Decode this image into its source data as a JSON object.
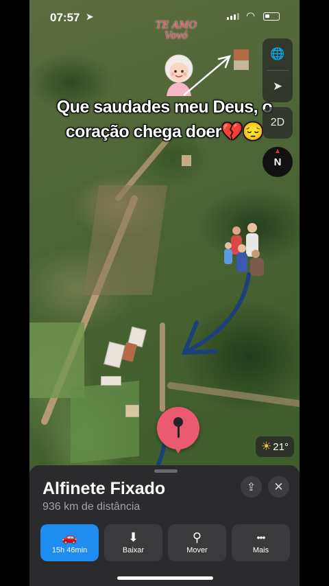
{
  "status_bar": {
    "time": "07:57"
  },
  "overlay": {
    "sticker_text_line1": "TE AMO",
    "sticker_text_line2": "Vovó",
    "caption_line1": "Que saudades meu Deus, o",
    "caption_line2": "coração chega doer💔😔"
  },
  "map_controls": {
    "globe_icon": "🌐",
    "location_icon": "➤",
    "view_mode_label": "2D",
    "compass_label": "N"
  },
  "weather": {
    "icon": "☀",
    "temperature": "21°"
  },
  "place_card": {
    "title": "Alfinete Fixado",
    "subtitle": "936 km de distância",
    "actions": [
      {
        "icon": "🚗",
        "label": "15h 46min"
      },
      {
        "icon": "⬇",
        "label": "Baixar"
      },
      {
        "icon": "⚲",
        "label": "Mover"
      },
      {
        "icon": "•••",
        "label": "Mais"
      }
    ]
  },
  "colors": {
    "accent": "#1f8cf0",
    "pin": "#e95a6f",
    "sheet_bg": "#2b2b2d",
    "arrow": "#1d3f7a"
  }
}
